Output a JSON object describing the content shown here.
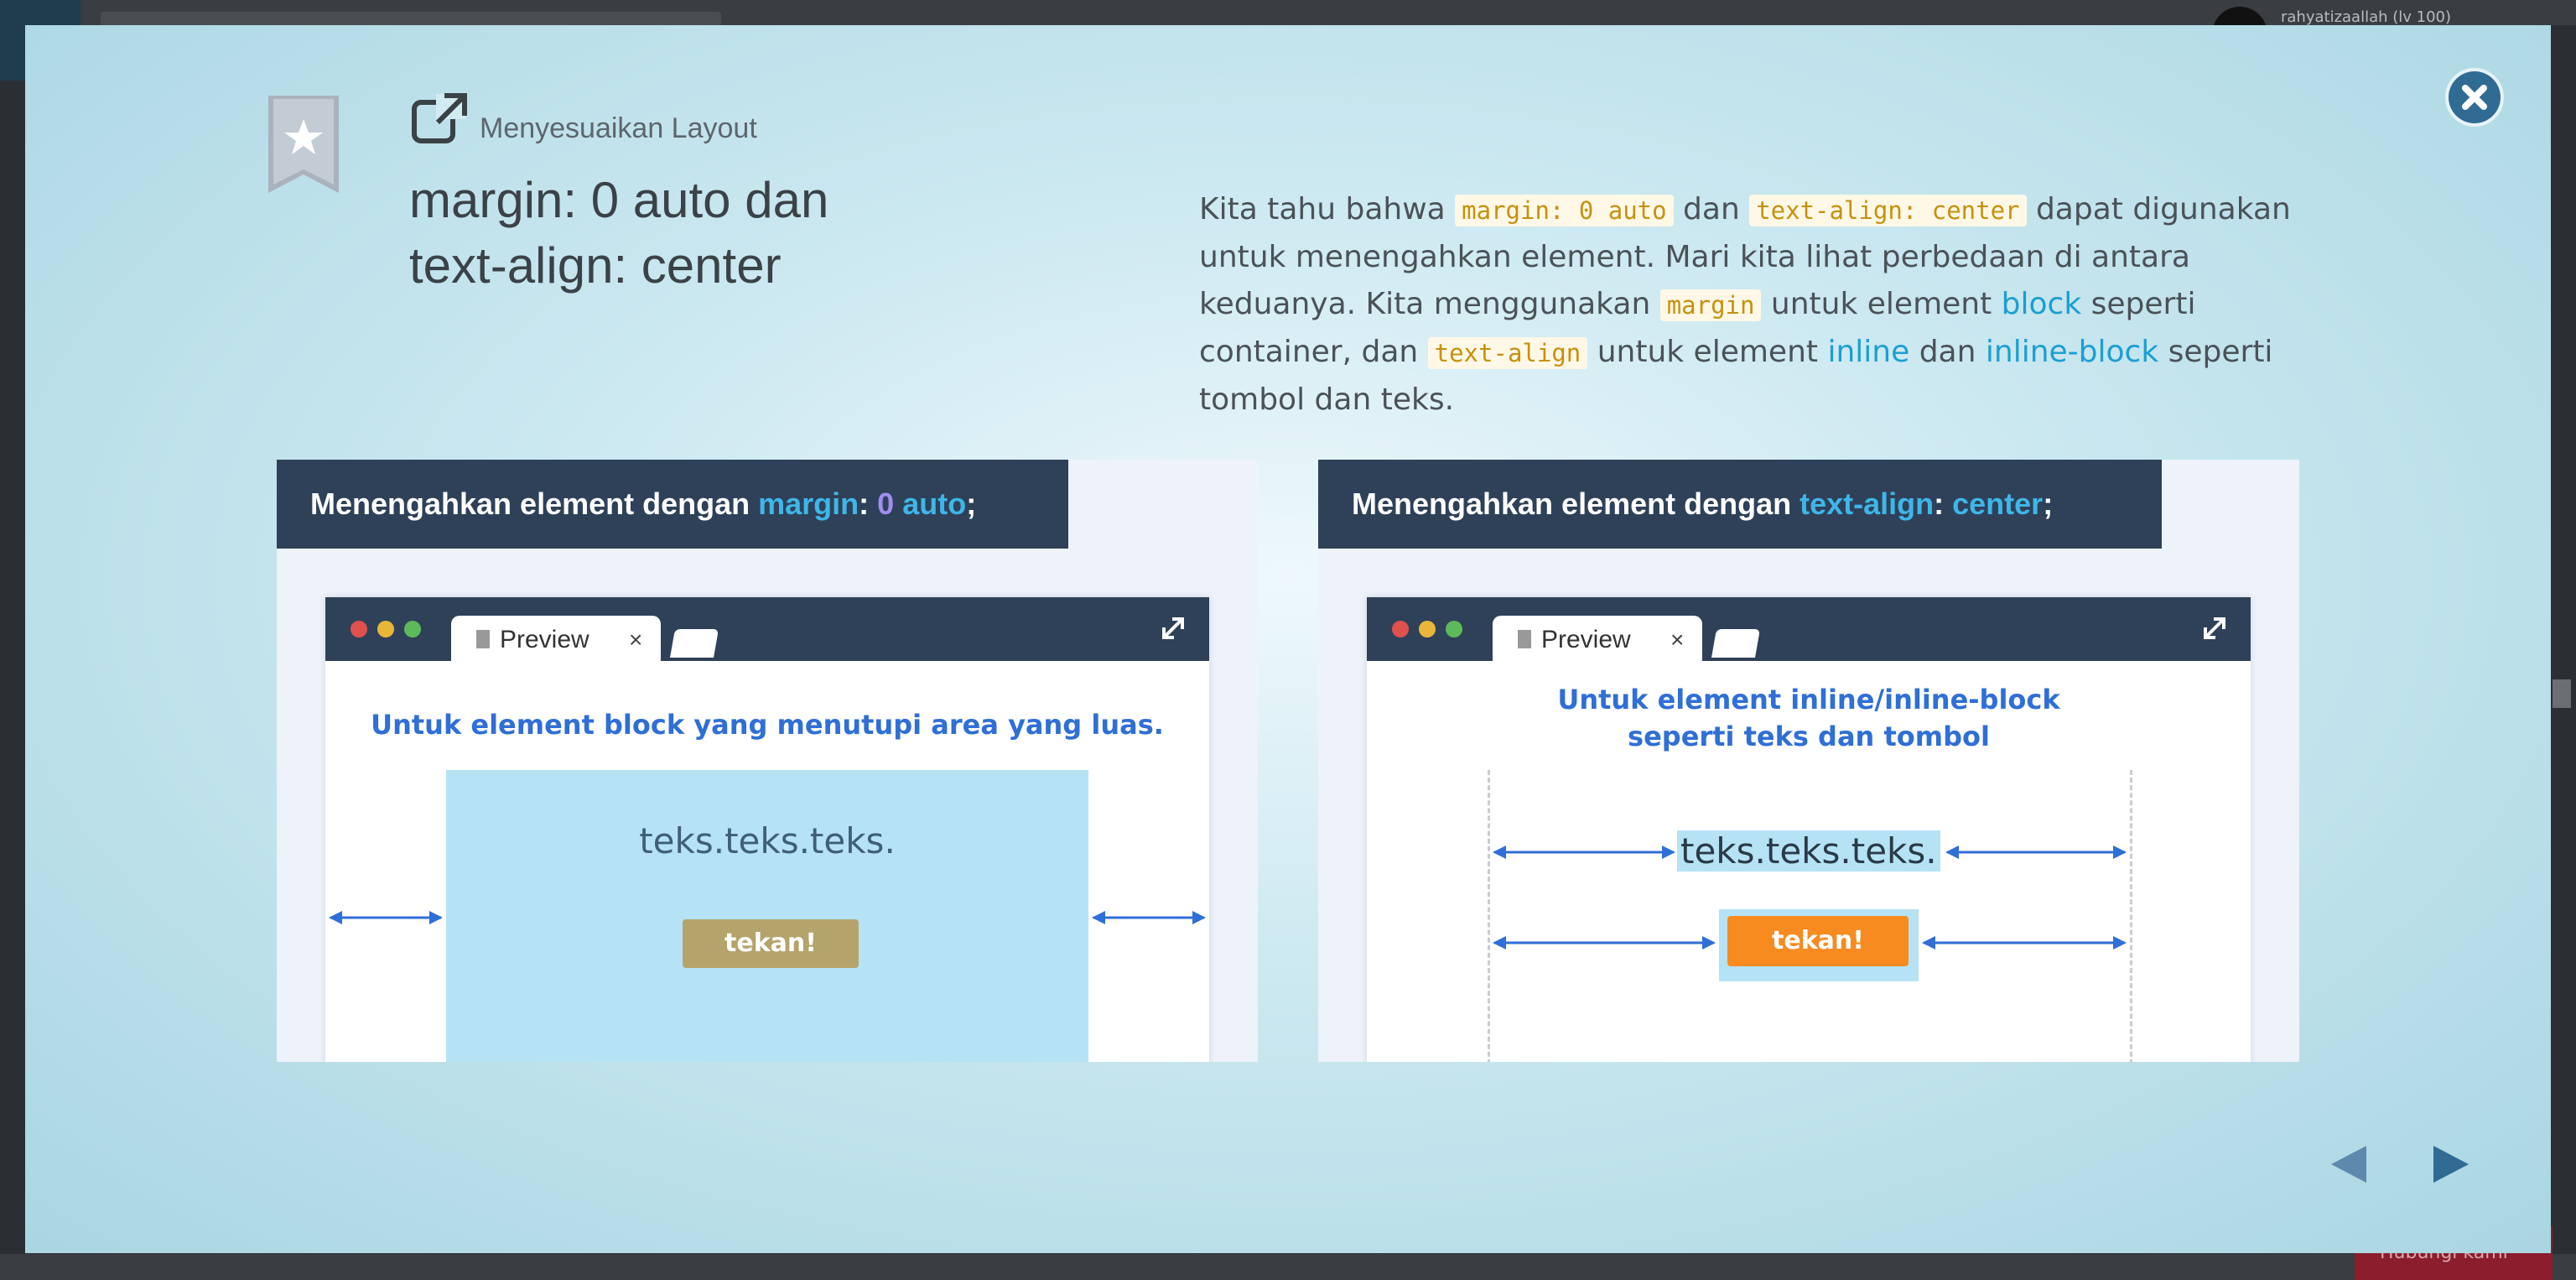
{
  "background": {
    "user_name": "rahyatizaallah (lv 100)",
    "help_label": "Hubungi kami"
  },
  "modal": {
    "kicker": "Menyesuaikan Layout",
    "title_line1": "margin: 0 auto dan",
    "title_line2": "text-align: center",
    "description": {
      "t1": "Kita tahu bahwa ",
      "c1": "margin: 0 auto",
      "t2": " dan ",
      "c2": "text-align: center",
      "t3": " dapat digunakan untuk menengahkan element. Mari kita lihat perbedaan di antara keduanya. Kita menggunakan ",
      "c3": "margin",
      "t4": " untuk element ",
      "k1": "block",
      "t5": " seperti container, dan ",
      "c4": "text-align",
      "t6": " untuk element ",
      "k2": "inline",
      "t7": " dan ",
      "k3": "inline-block",
      "t8": " seperti tombol dan teks."
    }
  },
  "panels": [
    {
      "heading_prefix": "Menengahkan element dengan ",
      "heading_prop": "margin",
      "heading_colon": ": ",
      "heading_val1": "0",
      "heading_space": " ",
      "heading_val2": "auto",
      "heading_end": ";",
      "tab_label": "Preview",
      "tab_close": "×",
      "caption": "Untuk element block yang menutupi area yang luas.",
      "teks": "teks.teks.teks.",
      "button": "tekan!"
    },
    {
      "heading_prefix": "Menengahkan element dengan ",
      "heading_prop": "text-align",
      "heading_colon": ": ",
      "heading_val": "center",
      "heading_end": ";",
      "tab_label": "Preview",
      "tab_close": "×",
      "caption_line1": "Untuk element inline/inline-block",
      "caption_line2": "seperti teks dan tombol",
      "teks": "teks.teks.teks.",
      "button": "tekan!"
    }
  ],
  "colors": {
    "accent": "#2f6b93",
    "code_text": "#c7910d",
    "keyword": "#1b9fd3",
    "panel_header": "#2e4159",
    "button_left": "#b5a36c",
    "button_right": "#f78b1f"
  },
  "icons": {
    "close": "close-icon",
    "bookmark": "bookmark-star-icon",
    "external": "external-link-icon",
    "prev": "triangle-left-icon",
    "next": "triangle-right-icon"
  }
}
